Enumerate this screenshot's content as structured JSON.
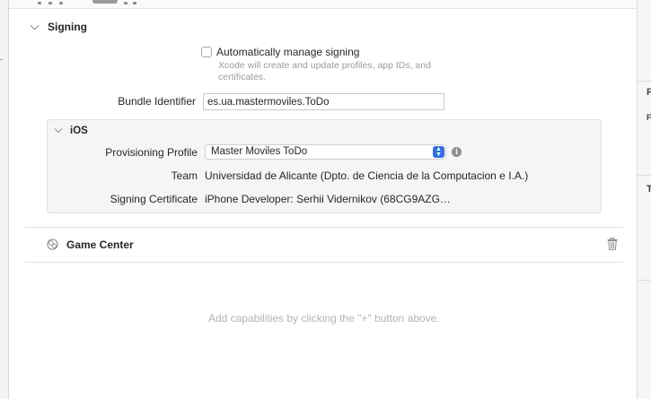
{
  "signing": {
    "section_title": "Signing",
    "auto_manage_label": "Automatically manage signing",
    "auto_manage_checked": false,
    "auto_manage_desc_line1": "Xcode will create and update profiles, app IDs, and",
    "auto_manage_desc_line2": "certificates.",
    "bundle_identifier_label": "Bundle Identifier",
    "bundle_identifier_value": "es.ua.mastermoviles.ToDo",
    "ios": {
      "title": "iOS",
      "provisioning_profile_label": "Provisioning Profile",
      "provisioning_profile_value": "Master Moviles ToDo",
      "team_label": "Team",
      "team_value": "Universidad de Alicante (Dpto. de Ciencia de la Computacion e I.A.)",
      "signing_certificate_label": "Signing Certificate",
      "signing_certificate_value": "iPhone Developer: Serhii Vidernikov (68CG9AZG…"
    }
  },
  "capabilities": {
    "game_center_label": "Game Center",
    "empty_hint": "Add capabilities by clicking the \"+\" button above."
  },
  "inspector": {
    "letter_1": "P",
    "letter_2": "F",
    "letter_3": "T"
  },
  "colors": {
    "accent": "#2f6fe0",
    "ios_box_bg": "#f5f5f5",
    "hint_text": "#b3b3b3"
  },
  "icons": {
    "section_toggle": "chevron-down-icon",
    "info": "info-icon",
    "game_center": "game-center-icon",
    "delete": "trash-icon"
  }
}
